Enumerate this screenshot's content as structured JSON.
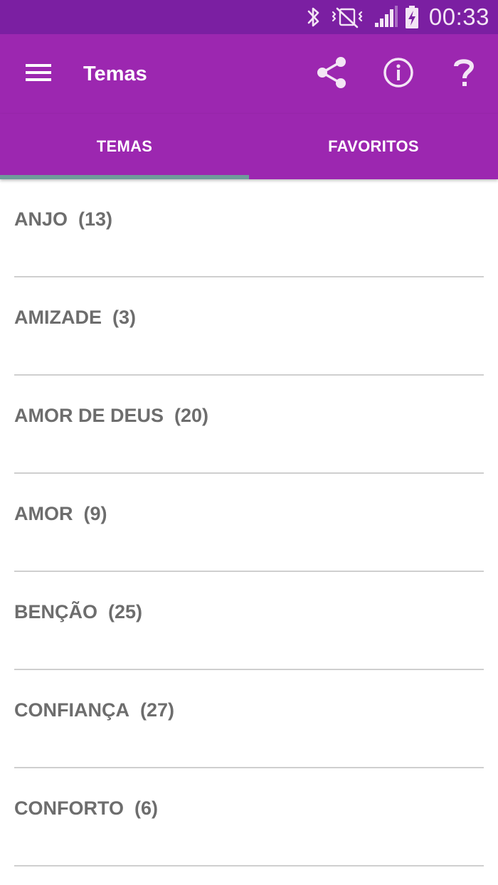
{
  "status_bar": {
    "time": "00:33",
    "icons": [
      "bluetooth-icon",
      "vibrate-mute-icon",
      "signal-icon",
      "battery-charging-icon"
    ]
  },
  "app_bar": {
    "title": "Temas",
    "menu_icon": "menu-icon",
    "action_icons": [
      "share-icon",
      "info-icon",
      "help-icon"
    ]
  },
  "tabs": [
    {
      "label": "TEMAS",
      "selected": true
    },
    {
      "label": "FAVORITOS",
      "selected": false
    }
  ],
  "list_items": [
    {
      "name": "ANJO",
      "count": "(13)"
    },
    {
      "name": "AMIZADE",
      "count": "(3)"
    },
    {
      "name": "AMOR DE DEUS",
      "count": "(20)"
    },
    {
      "name": "AMOR",
      "count": "(9)"
    },
    {
      "name": "BENÇÃO",
      "count": "(25)"
    },
    {
      "name": "CONFIANÇA",
      "count": "(27)"
    },
    {
      "name": "CONFORTO",
      "count": "(6)"
    }
  ],
  "colors": {
    "status_bar": "#7b1fa2",
    "app_bar": "#9c27b0",
    "tab_indicator": "#6e9b9b",
    "list_text": "#6d6d6d",
    "divider": "#cfcfcf"
  }
}
